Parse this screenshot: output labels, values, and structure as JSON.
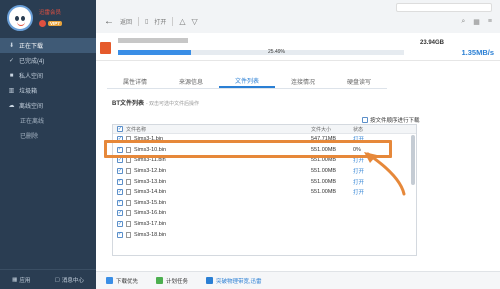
{
  "sidebar": {
    "username": "迅雷会员",
    "vip_label": "VIP7",
    "items": [
      {
        "label": "正在下载",
        "icon": "download-icon"
      },
      {
        "label": "已完成(4)",
        "icon": "check-icon"
      },
      {
        "label": "私人空间",
        "icon": "lock-icon"
      },
      {
        "label": "垃圾箱",
        "icon": "trash-icon"
      },
      {
        "label": "离线空间",
        "icon": "cloud-icon"
      },
      {
        "label": "正在离线"
      },
      {
        "label": "已删除"
      }
    ],
    "bottom": {
      "apps": "应用",
      "messages": "消息中心"
    }
  },
  "toolbar": {
    "back": "返回",
    "open": "打开"
  },
  "download": {
    "total_size": "23.94GB",
    "speed": "1.35MB/s",
    "progress_text": "25.49%",
    "progress": 25.49
  },
  "tabs": [
    {
      "label": "属性详情",
      "active": false
    },
    {
      "label": "来源信息",
      "active": false
    },
    {
      "label": "文件列表",
      "active": true
    },
    {
      "label": "连接情况",
      "active": false
    },
    {
      "label": "硬盘读写",
      "active": false
    }
  ],
  "file_list": {
    "title": "BT文件列表",
    "hint": "- 双击可选中文件后操作",
    "order_option": "按文件顺序进行下载",
    "headers": {
      "name": "文件名称",
      "size": "文件大小",
      "status": "状态"
    },
    "rows": [
      {
        "name": "Sims3-1.bin",
        "size": "547.71MB",
        "status": "打开"
      },
      {
        "name": "Sims3-10.bin",
        "size": "551.00MB",
        "status": "0%"
      },
      {
        "name": "Sims3-11.bin",
        "size": "551.00MB",
        "status": "打开"
      },
      {
        "name": "Sims3-12.bin",
        "size": "551.00MB",
        "status": "打开"
      },
      {
        "name": "Sims3-13.bin",
        "size": "551.00MB",
        "status": "打开"
      },
      {
        "name": "Sims3-14.bin",
        "size": "551.00MB",
        "status": "打开"
      },
      {
        "name": "Sims3-15.bin",
        "size": "",
        "status": ""
      },
      {
        "name": "Sims3-16.bin",
        "size": "",
        "status": ""
      },
      {
        "name": "Sims3-17.bin",
        "size": "",
        "status": ""
      },
      {
        "name": "Sims3-18.bin",
        "size": "",
        "status": ""
      }
    ]
  },
  "bottombar": {
    "priority": "下载优先",
    "plan": "计划任务",
    "link": "突破物理带宽,迅雷"
  },
  "colors": {
    "accent": "#2a7fd4",
    "highlight": "#e6883a",
    "sidebar": "#2a3d52"
  }
}
